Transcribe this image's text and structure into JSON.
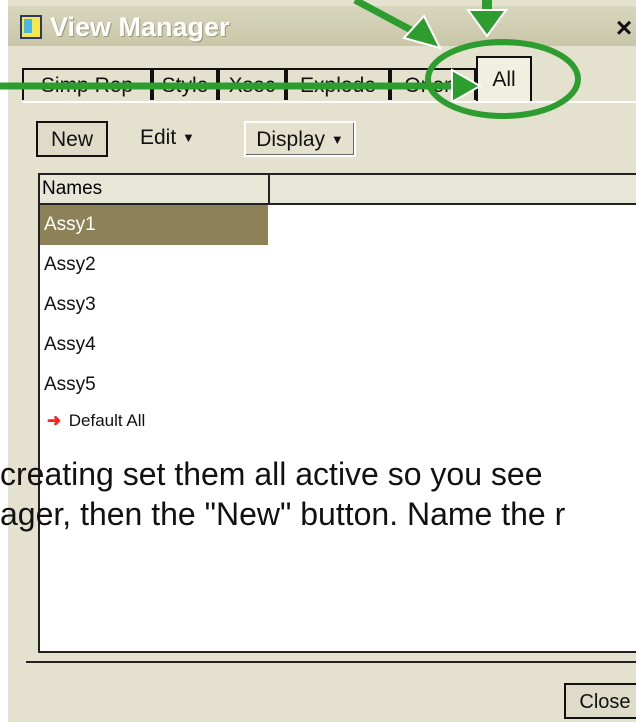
{
  "window": {
    "title": "View Manager",
    "close_symbol": "×"
  },
  "tabs": [
    {
      "label": "Simp Rep"
    },
    {
      "label": "Style"
    },
    {
      "label": "Xsec"
    },
    {
      "label": "Explode"
    },
    {
      "label": "Orient"
    },
    {
      "label": "All"
    }
  ],
  "toolbar": {
    "new_label": "New",
    "edit_label": "Edit",
    "display_label": "Display"
  },
  "list": {
    "column_header": "Names",
    "items": [
      "Assy1",
      "Assy2",
      "Assy3",
      "Assy4",
      "Assy5"
    ],
    "default_label": "Default All",
    "selected_index": 0
  },
  "overlay_text": {
    "line1": "creating set them all active so you see",
    "line2": "ager, then the \"New\" button. Name the r"
  },
  "footer": {
    "close_label": "Close"
  },
  "colors": {
    "annotation_green": "#2e9d2f",
    "selection": "#8d8157",
    "dialog_bg": "#e4e2cf"
  },
  "icons": [
    "view-manager-icon",
    "close-icon",
    "chevron-down-icon",
    "red-arrow-icon"
  ]
}
